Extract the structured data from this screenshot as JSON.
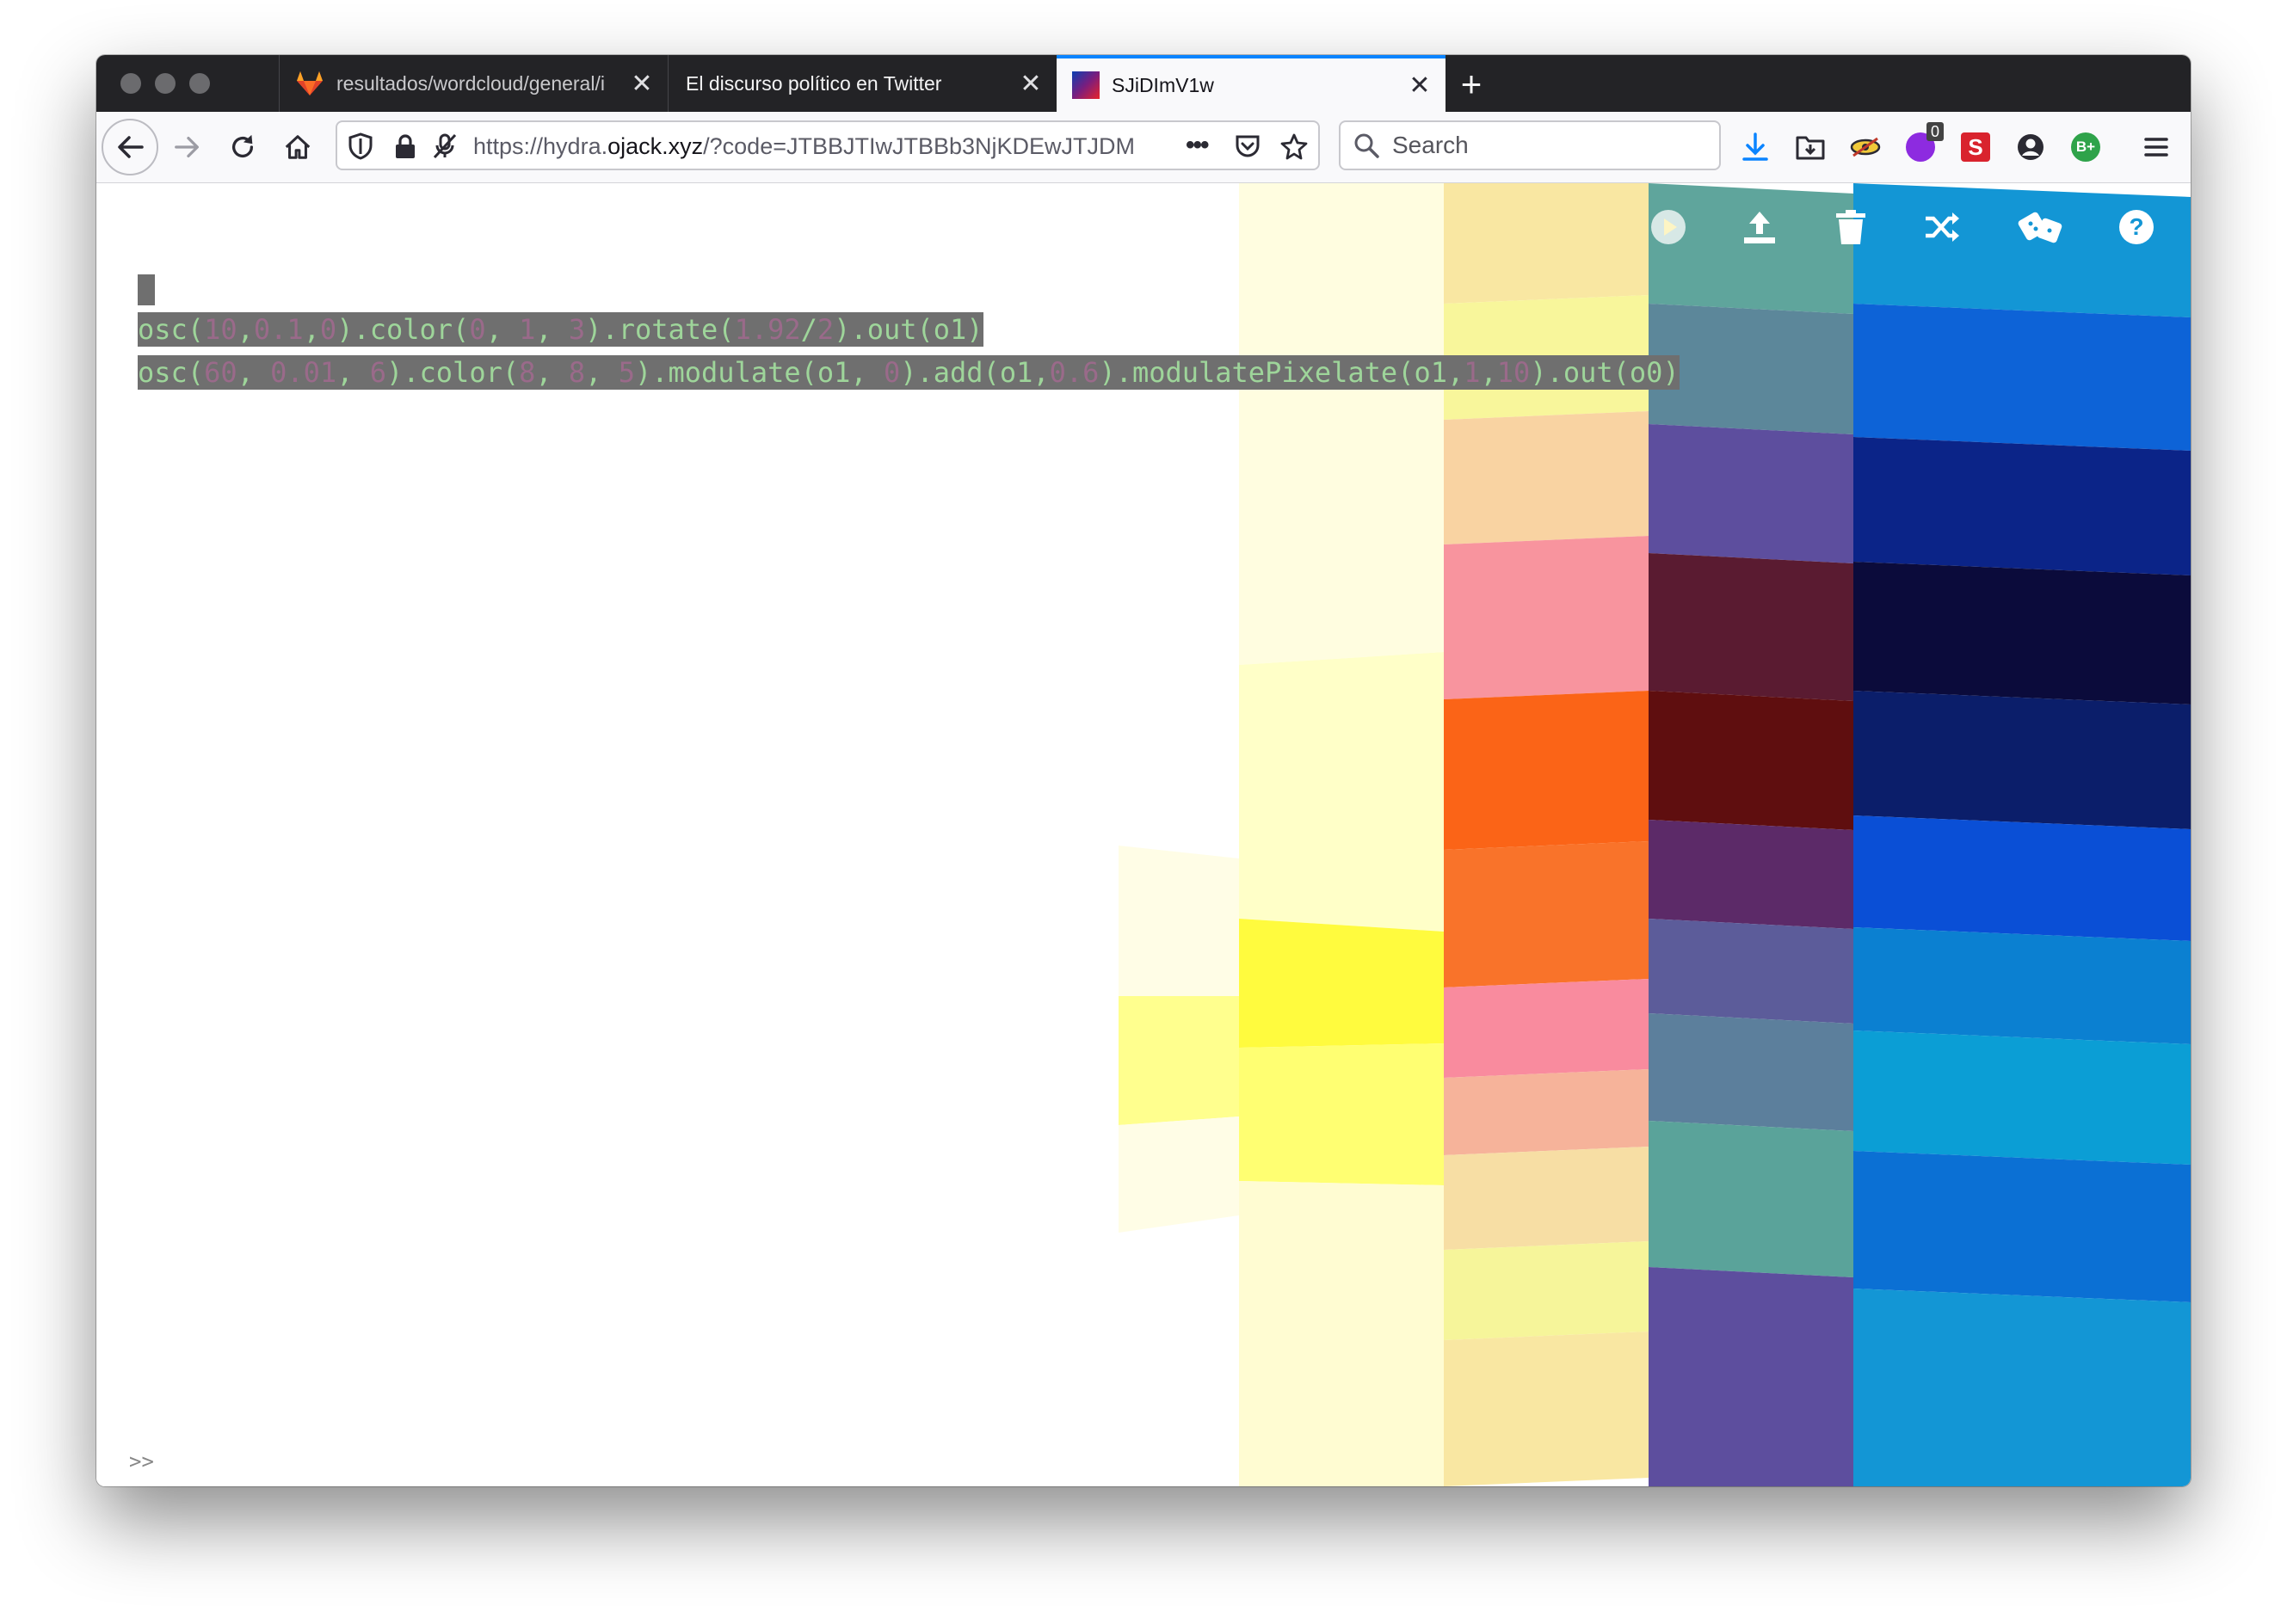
{
  "browser": {
    "tabs": [
      {
        "title": "resultados/wordcloud/general/i",
        "icon": "gitlab-icon",
        "active": false
      },
      {
        "title": "El discurso político en Twitter",
        "icon": "none",
        "active": false
      },
      {
        "title": "SJiDImV1w",
        "icon": "hydra-favicon",
        "active": true
      }
    ],
    "url": {
      "prefix": "https://hydra.",
      "domain": "ojack.xyz",
      "rest": "/?code=JTBBJTIwJTBBb3NjKDEwJTJDM"
    },
    "search_placeholder": "Search",
    "extension_badge": "0",
    "extension_label_s": "S",
    "extension_label_b": "B+"
  },
  "toolbar_icons": [
    "back-arrow-icon",
    "forward-arrow-icon",
    "reload-icon",
    "home-icon",
    "shield-icon",
    "lock-icon",
    "permissions-icon",
    "more-icon",
    "pocket-icon",
    "star-icon",
    "search-icon",
    "download-icon",
    "library-icon",
    "extension-eye-icon",
    "extension-badge-icon",
    "extension-s-icon",
    "account-icon",
    "extension-b-icon",
    "menu-icon"
  ],
  "hydra": {
    "toolbar": [
      "run-icon",
      "upload-icon",
      "trash-icon",
      "shuffle-icon",
      "dice-icon",
      "help-icon"
    ],
    "code_lines": [
      [
        {
          "t": "osc",
          "k": "fn"
        },
        {
          "t": "(",
          "k": "p"
        },
        {
          "t": "10",
          "k": "n"
        },
        {
          "t": ",",
          "k": "p"
        },
        {
          "t": "0.1",
          "k": "n"
        },
        {
          "t": ",",
          "k": "p"
        },
        {
          "t": "0",
          "k": "n"
        },
        {
          "t": ").color(",
          "k": "p"
        },
        {
          "t": "0",
          "k": "n"
        },
        {
          "t": ", ",
          "k": "p"
        },
        {
          "t": "1",
          "k": "n"
        },
        {
          "t": ", ",
          "k": "p"
        },
        {
          "t": "3",
          "k": "n"
        },
        {
          "t": ").rotate(",
          "k": "p"
        },
        {
          "t": "1.92",
          "k": "n"
        },
        {
          "t": "/",
          "k": "p"
        },
        {
          "t": "2",
          "k": "n"
        },
        {
          "t": ").out(o1)",
          "k": "p"
        }
      ],
      [
        {
          "t": "osc",
          "k": "fn"
        },
        {
          "t": "(",
          "k": "p"
        },
        {
          "t": "60",
          "k": "n"
        },
        {
          "t": ", ",
          "k": "p"
        },
        {
          "t": "0.01",
          "k": "n"
        },
        {
          "t": ", ",
          "k": "p"
        },
        {
          "t": "6",
          "k": "n"
        },
        {
          "t": ").color(",
          "k": "p"
        },
        {
          "t": "8",
          "k": "n"
        },
        {
          "t": ", ",
          "k": "p"
        },
        {
          "t": "8",
          "k": "n"
        },
        {
          "t": ", ",
          "k": "p"
        },
        {
          "t": "5",
          "k": "n"
        },
        {
          "t": ").modulate(o1, ",
          "k": "p"
        },
        {
          "t": "0",
          "k": "n"
        },
        {
          "t": ").add(o1,",
          "k": "p"
        },
        {
          "t": "0.6",
          "k": "n"
        },
        {
          "t": ").modulatePixelate(o1,",
          "k": "p"
        },
        {
          "t": "1",
          "k": "n"
        },
        {
          "t": ",",
          "k": "p"
        },
        {
          "t": "10",
          "k": "n"
        },
        {
          "t": ").out(o0)",
          "k": "p"
        }
      ]
    ],
    "prompt": ">>",
    "visual_colors": {
      "col1": [
        "#fffde0",
        "#ffffc8",
        "#fffb3e",
        "#ffff72",
        "#fffcd2"
      ],
      "col2": [
        "#f9e7a2",
        "#f8f69b",
        "#f9d3a2",
        "#f8949e",
        "#fb6417",
        "#f9732a",
        "#f98b9e",
        "#f6b39a",
        "#f7dea4",
        "#f6f59a"
      ],
      "col3": [
        "#5fa59c",
        "#5c879a",
        "#5d4e9e",
        "#5a1b31",
        "#5f0e0f",
        "#5c2a68",
        "#5c5c9a",
        "#5c7f9c",
        "#5aa39a"
      ],
      "col4": [
        "#1396d5",
        "#0d63d7",
        "#0b2488",
        "#0b0b3b",
        "#0b1e6a",
        "#0a4fd6",
        "#0b80d1",
        "#0b9ed5",
        "#0b70d4"
      ]
    }
  }
}
